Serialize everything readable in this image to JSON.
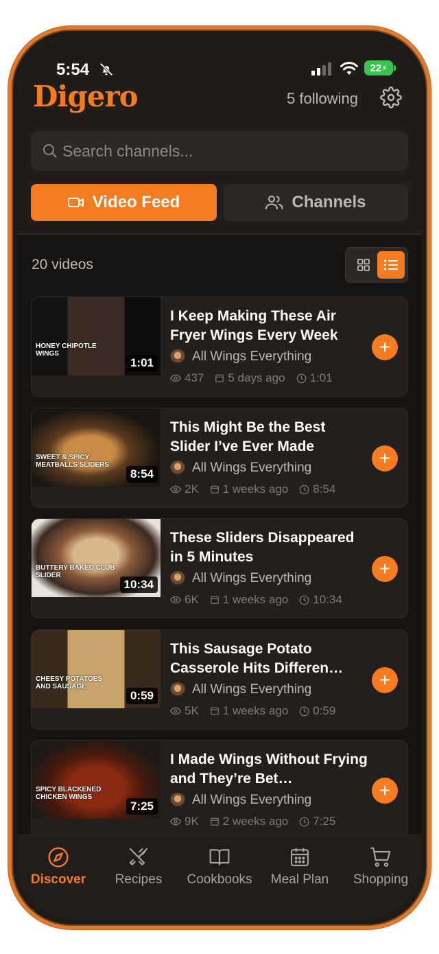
{
  "status_bar": {
    "time": "5:54",
    "battery": "22"
  },
  "header": {
    "logo": "Digero",
    "following": "5 following"
  },
  "search": {
    "placeholder": "Search channels..."
  },
  "tabs": {
    "video_feed": "Video Feed",
    "channels": "Channels"
  },
  "feed": {
    "count": "20 videos"
  },
  "videos": [
    {
      "title": "I Keep Making These Air Fryer Wings Every Week",
      "channel": "All Wings Everything",
      "views": "437",
      "age": "5 days ago",
      "duration": "1:01"
    },
    {
      "title": "This Might Be the Best Slider I’ve Ever Made",
      "channel": "All Wings Everything",
      "views": "2K",
      "age": "1 weeks ago",
      "duration": "8:54"
    },
    {
      "title": "These Sliders Disappeared in 5 Minutes",
      "channel": "All Wings Everything",
      "views": "6K",
      "age": "1 weeks ago",
      "duration": "10:34"
    },
    {
      "title": "This Sausage Potato Casserole Hits Differen…",
      "channel": "All Wings Everything",
      "views": "5K",
      "age": "1 weeks ago",
      "duration": "0:59"
    },
    {
      "title": "I Made Wings Without Frying and They’re Bet…",
      "channel": "All Wings Everything",
      "views": "9K",
      "age": "2 weeks ago",
      "duration": "7:25"
    }
  ],
  "thumb_captions": [
    "HONEY CHIPOTLE WINGS",
    "SWEET & SPICY MEATBALLS SLIDERS",
    "BUTTERY BAKED CLUB SLIDER",
    "CHEESY POTATOES AND SAUSAGE",
    "SPICY BLACKENED CHICKEN WINGS"
  ],
  "bottom_nav": [
    "Discover",
    "Recipes",
    "Cookbooks",
    "Meal Plan",
    "Shopping"
  ],
  "colors": {
    "accent": "#f47b20",
    "background": "#1f1c1a",
    "card": "#221f1d"
  }
}
